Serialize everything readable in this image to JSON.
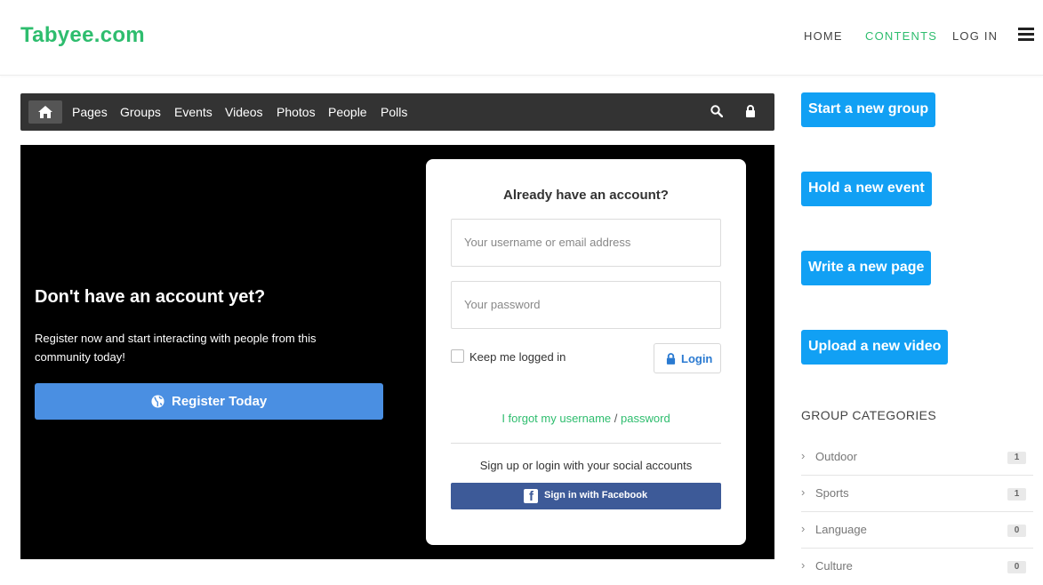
{
  "header": {
    "logo": "Tabyee.com",
    "nav": [
      {
        "label": "HOME",
        "active": false
      },
      {
        "label": "CONTENTS",
        "active": true
      },
      {
        "label": "LOG IN",
        "active": false
      }
    ],
    "menu_icon": "hamburger-icon"
  },
  "subnav": {
    "home_icon": "home-icon",
    "items": [
      "Pages",
      "Groups",
      "Events",
      "Videos",
      "Photos",
      "People",
      "Polls"
    ],
    "search_icon": "search-icon",
    "lock_icon": "lock-icon"
  },
  "hero": {
    "heading": "Don't have an account yet?",
    "text": "Register now and start interacting with people from this community today!",
    "register_label": "Register Today",
    "register_icon": "globe-icon"
  },
  "login": {
    "title": "Already have an account?",
    "username_placeholder": "Your username or email address",
    "password_placeholder": "Your password",
    "remember_label": "Keep me logged in",
    "login_label": "Login",
    "forgot_username": "I forgot my username",
    "forgot_sep": "/",
    "forgot_password": "password",
    "social_text": "Sign up or login with your social accounts",
    "facebook_label": "Sign in with Facebook"
  },
  "sidebar": {
    "actions": [
      "Start a new group",
      "Hold a new event",
      "Write a new page",
      "Upload a new video"
    ],
    "categories_title": "GROUP CATEGORIES",
    "categories": [
      {
        "name": "Outdoor",
        "count": "1"
      },
      {
        "name": "Sports",
        "count": "1"
      },
      {
        "name": "Language",
        "count": "0"
      },
      {
        "name": "Culture",
        "count": "0"
      }
    ]
  },
  "colors": {
    "brand_green": "#2ebd6e",
    "action_blue": "#11a0f4",
    "register_blue": "#4a8fe2",
    "facebook_blue": "#3d5a98",
    "subnav_bg": "#333333"
  }
}
